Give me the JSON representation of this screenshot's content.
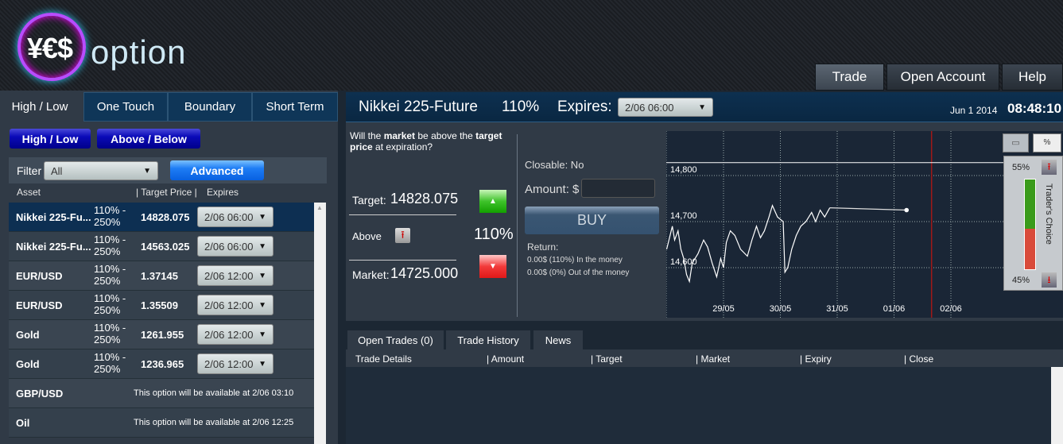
{
  "brand": {
    "logo_text": "YES option"
  },
  "nav": [
    {
      "label": "Trade"
    },
    {
      "label": "Open Account"
    },
    {
      "label": "Help"
    }
  ],
  "left": {
    "tabs": [
      {
        "label": "High / Low"
      },
      {
        "label": "One Touch"
      },
      {
        "label": "Boundary"
      },
      {
        "label": "Short Term"
      }
    ],
    "subtabs": [
      {
        "label": "High / Low"
      },
      {
        "label": "Above / Below"
      }
    ],
    "filter_label": "Filter",
    "filter_value": "All",
    "advanced_label": "Advanced",
    "columns": {
      "asset": "Asset",
      "target": "| Target Price |",
      "expires": "Expires"
    },
    "assets": [
      {
        "name": "Nikkei 225-Fu...",
        "pct1": "110% -",
        "pct2": "250%",
        "target": "14828.075",
        "expires": "2/06 06:00"
      },
      {
        "name": "Nikkei 225-Fu...",
        "pct1": "110% -",
        "pct2": "250%",
        "target": "14563.025",
        "expires": "2/06 06:00"
      },
      {
        "name": "EUR/USD",
        "pct1": "110% -",
        "pct2": "250%",
        "target": "1.37145",
        "expires": "2/06 12:00"
      },
      {
        "name": "EUR/USD",
        "pct1": "110% -",
        "pct2": "250%",
        "target": "1.35509",
        "expires": "2/06 12:00"
      },
      {
        "name": "Gold",
        "pct1": "110% -",
        "pct2": "250%",
        "target": "1261.955",
        "expires": "2/06 12:00"
      },
      {
        "name": "Gold",
        "pct1": "110% -",
        "pct2": "250%",
        "target": "1236.965",
        "expires": "2/06 12:00"
      },
      {
        "name": "GBP/USD",
        "message": "This option will be available at 2/06 03:10"
      },
      {
        "name": "Oil",
        "message": "This option will be available at 2/06 12:25"
      }
    ]
  },
  "main": {
    "asset": "Nikkei 225-Future",
    "payout": "110%",
    "expires_label": "Expires:",
    "expires_value": "2/06 06:00",
    "date": "Jun 1 2014",
    "time": "08:48:10",
    "question_parts": [
      "Will the ",
      "market",
      " be above the ",
      "target price",
      " at expiration?"
    ],
    "target_label": "Target:",
    "target_value": "14828.075",
    "direction_label": "Above",
    "percent": "110%",
    "market_label": "Market:",
    "market_value": "14725.000",
    "closable": "Closable: No",
    "amount_label": "Amount: $",
    "amount_value": "",
    "buy_label": "BUY",
    "return_label": "Return:",
    "return_in": "0.00$ (110%) In the money",
    "return_out": "0.00$ (0%) Out of the money"
  },
  "chart": {
    "y_ticks": [
      "14,800",
      "14,700",
      "14,600"
    ],
    "y_tick_values": [
      14800,
      14700,
      14600
    ],
    "x_ticks": [
      "29/05",
      "30/05",
      "31/05",
      "01/06",
      "02/06"
    ],
    "x_tick_days": [
      1,
      2,
      3,
      4,
      5
    ],
    "target": 14828.075,
    "expiry_day": 4.66,
    "series": [
      [
        0,
        14640
      ],
      [
        0.05,
        14665
      ],
      [
        0.1,
        14690
      ],
      [
        0.14,
        14660
      ],
      [
        0.2,
        14680
      ],
      [
        0.25,
        14640
      ],
      [
        0.3,
        14620
      ],
      [
        0.35,
        14585
      ],
      [
        0.4,
        14570
      ],
      [
        0.45,
        14610
      ],
      [
        0.55,
        14630
      ],
      [
        0.65,
        14660
      ],
      [
        0.72,
        14645
      ],
      [
        0.8,
        14610
      ],
      [
        0.88,
        14580
      ],
      [
        0.95,
        14620
      ],
      [
        1.0,
        14600
      ],
      [
        1.05,
        14655
      ],
      [
        1.12,
        14680
      ],
      [
        1.2,
        14670
      ],
      [
        1.3,
        14640
      ],
      [
        1.42,
        14625
      ],
      [
        1.5,
        14660
      ],
      [
        1.58,
        14690
      ],
      [
        1.65,
        14665
      ],
      [
        1.72,
        14680
      ],
      [
        1.8,
        14710
      ],
      [
        1.86,
        14735
      ],
      [
        1.95,
        14710
      ],
      [
        2.05,
        14700
      ],
      [
        2.08,
        14590
      ],
      [
        2.13,
        14600
      ],
      [
        2.2,
        14640
      ],
      [
        2.28,
        14670
      ],
      [
        2.36,
        14690
      ],
      [
        2.45,
        14700
      ],
      [
        2.55,
        14720
      ],
      [
        2.62,
        14700
      ],
      [
        2.7,
        14725
      ],
      [
        2.78,
        14710
      ],
      [
        2.87,
        14730
      ]
    ],
    "last_point": [
      4.22,
      14725
    ],
    "buttons": {
      "percent": "%"
    },
    "traders_choice": {
      "label": "Trader's Choice",
      "up": "55%",
      "down": "45%",
      "up_fraction": 0.55
    }
  },
  "bottom": {
    "tabs": [
      {
        "label": "Open Trades (0)"
      },
      {
        "label": "Trade History"
      },
      {
        "label": "News"
      }
    ],
    "columns": [
      "Trade Details",
      "| Amount",
      "| Target",
      "| Market",
      "| Expiry",
      "| Close"
    ]
  },
  "colors": {
    "accent": "#0d2f52",
    "green": "#3a9b1a",
    "red": "#d94a3a"
  }
}
